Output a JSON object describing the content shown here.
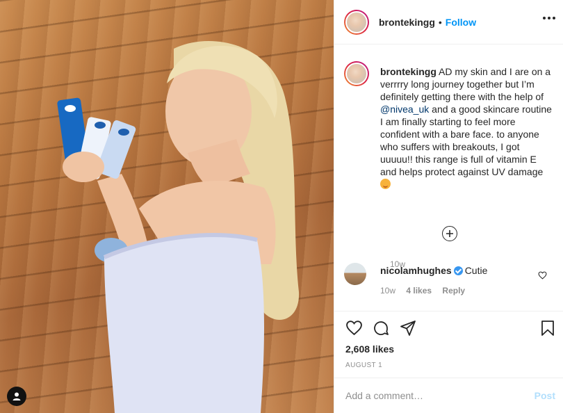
{
  "post": {
    "username": "brontekingg",
    "separator": "•",
    "follow_label": "Follow",
    "more_icon": "more-options-icon"
  },
  "caption": {
    "username": "brontekingg",
    "text_part1": " AD my skin and I are on a verrrry long journey together but I’m definitely getting there with the help of ",
    "mention": "@nivea_uk",
    "text_part2": " and a good skincare routine I am finally starting to feel more confident with a bare face. to anyone who suffers with breakouts, I got uuuuu!! this range is full of vitamin E and helps protect against UV damage ",
    "emoji": "smiling-face-emoji",
    "time": "10w"
  },
  "load_more_icon": "plus-circle-icon",
  "comment": {
    "username": "nicolamhughes",
    "verified_icon": "verified-badge-icon",
    "text": "Cutie",
    "time": "10w",
    "likes": "4 likes",
    "reply_label": "Reply"
  },
  "actions": {
    "like_icon": "heart-icon",
    "comment_icon": "comment-icon",
    "share_icon": "share-icon",
    "save_icon": "bookmark-icon"
  },
  "likes_count": "2,608 likes",
  "date": "AUGUST 1",
  "add_comment": {
    "placeholder": "Add a comment…",
    "post_label": "Post"
  },
  "colors": {
    "accent": "#0095f6",
    "mention": "#00376b",
    "muted": "#8e8e8e",
    "post_disabled": "#b2dffc"
  }
}
